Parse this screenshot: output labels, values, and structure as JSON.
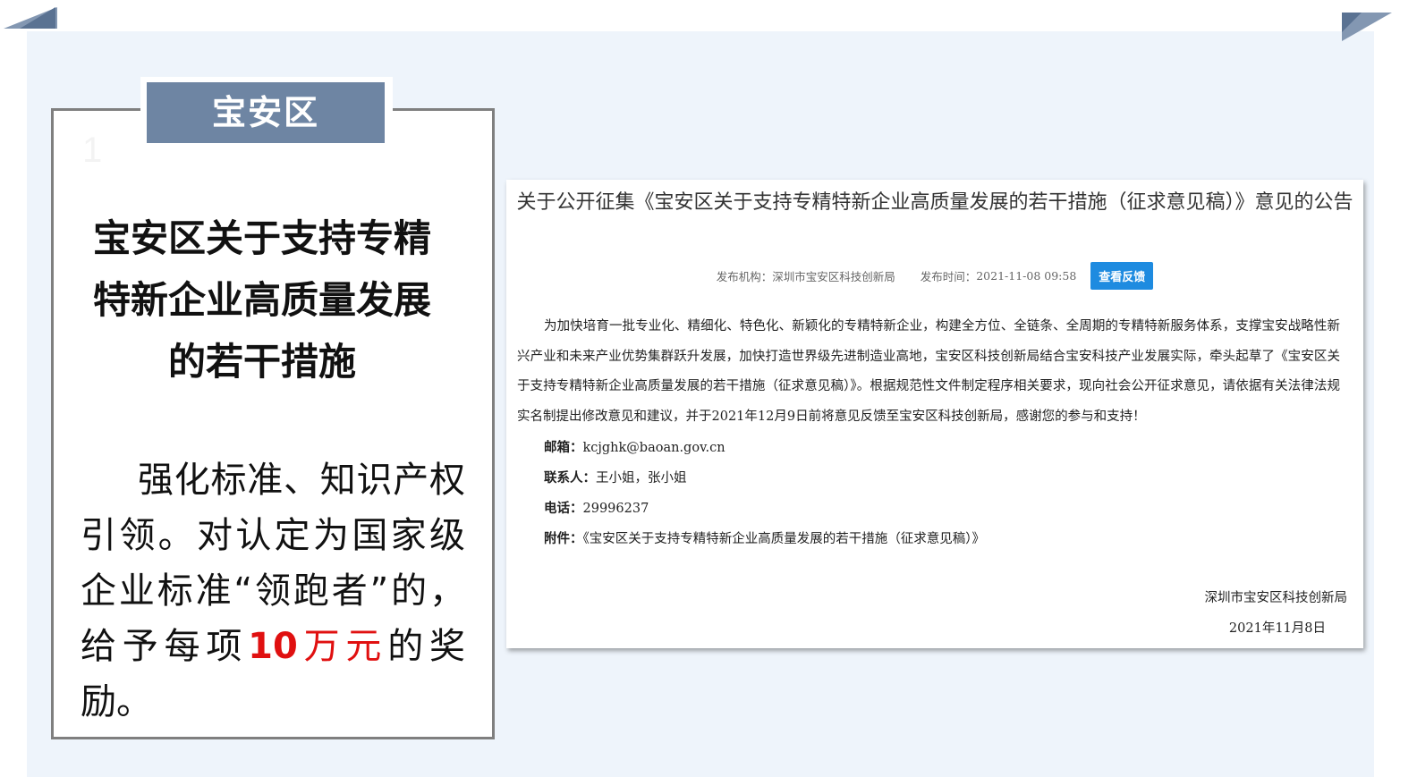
{
  "left_card": {
    "tab_label": "宝安区",
    "faint_number": "1",
    "title_lines": [
      "宝安区关于支持专精",
      "特新企业高质量发展",
      "的若干措施"
    ],
    "body_before": "强化标准、知识产权引领。对认定为国家级企业标准“领跑者”的，给予每项",
    "body_highlight_number": "10",
    "body_highlight_unit": "万元",
    "body_after": "的奖励。"
  },
  "notice": {
    "title": "关于公开征集《宝安区关于支持专精特新企业高质量发展的若干措施（征求意见稿）》意见的公告",
    "publisher_label": "发布机构：",
    "publisher": "深圳市宝安区科技创新局",
    "time_label": "发布时间：",
    "time": "2021-11-08 09:58",
    "feedback_button": "查看反馈",
    "paragraph": "为加快培育一批专业化、精细化、特色化、新颖化的专精特新企业，构建全方位、全链条、全周期的专精特新服务体系，支撑宝安战略性新兴产业和未来产业优势集群跃升发展，加快打造世界级先进制造业高地，宝安区科技创新局结合宝安科技产业发展实际，牵头起草了《宝安区关于支持专精特新企业高质量发展的若干措施（征求意见稿）》。根据规范性文件制定程序相关要求，现向社会公开征求意见，请依据有关法律法规实名制提出修改意见和建议，并于2021年12月9日前将意见反馈至宝安区科技创新局，感谢您的参与和支持！",
    "email_label": "邮箱：",
    "email": "kcjghk@baoan.gov.cn",
    "contact_label": "联系人：",
    "contact": "王小姐，张小姐",
    "phone_label": "电话：",
    "phone": "29996237",
    "attachment_label": "附件：",
    "attachment": "《宝安区关于支持专精特新企业高质量发展的若干措施（征求意见稿）》",
    "signature": "深圳市宝安区科技创新局",
    "date": "2021年11月8日"
  },
  "colors": {
    "tab_bg": "#6e85a3",
    "highlight": "#e01010",
    "panel_bg": "#eef4fb",
    "button_bg": "#1e8be0"
  }
}
